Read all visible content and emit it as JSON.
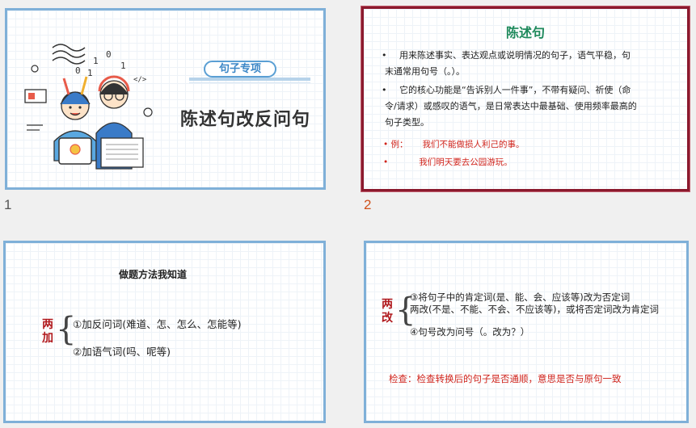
{
  "slides": [
    {
      "number": "1",
      "tag": "句子专项",
      "title": "陈述句改反问句"
    },
    {
      "number": "2",
      "title": "陈述句",
      "bullets": [
        {
          "marker": "•",
          "text_line1": "用来陈述事实、表达观点或说明情况的句子，语气平稳，句",
          "text_line2": "末通常用句号（。）。"
        },
        {
          "marker": "•",
          "text_line1": "它的核心功能是“告诉别人一件事”，不带有疑问、祈使（命",
          "text_line2": "令/请求）或感叹的语气，是日常表达中最基础、使用频率最高的",
          "text_line3": "句子类型。"
        }
      ],
      "examples": [
        {
          "marker": "• 例：",
          "text": "我们不能做损人利己的事。"
        },
        {
          "marker": "•",
          "text": "我们明天要去公园游玩。"
        }
      ]
    },
    {
      "number": "",
      "heading": "做题方法我知道",
      "label": [
        "两",
        "加"
      ],
      "items": [
        "①加反问词(难道、怎、怎么、怎能等)",
        "②加语气词(吗、呢等)"
      ]
    },
    {
      "number": "",
      "label": [
        "两",
        "改"
      ],
      "item1_line1": "③将句子中的肯定词(是、能、会、应该等)改为否定词",
      "item1_line2": "两改(不是、不能、不会、不应该等)，或将否定词改为肯定词",
      "item2": "④句号改为问号（。改为？）",
      "check": "检查：检查转换后的句子是否通顺，意思是否与原句一致"
    }
  ],
  "colors": {
    "slide_border": "#7fb0d8",
    "selected_border": "#8b1a2e",
    "title_green": "#1f8a5c",
    "red_text": "#d0241c",
    "tag_blue": "#3a86c6"
  }
}
